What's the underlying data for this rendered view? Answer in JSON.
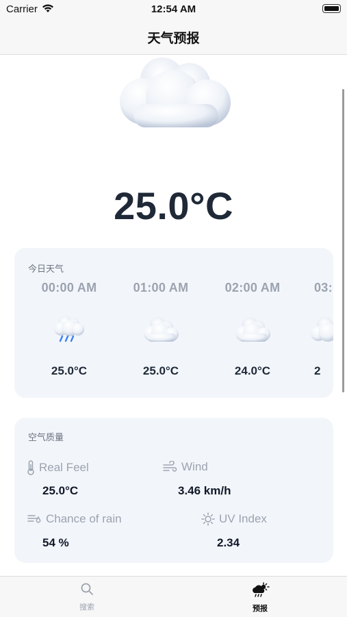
{
  "status_bar": {
    "carrier": "Carrier",
    "time": "12:54 AM"
  },
  "nav": {
    "title": "天气预报"
  },
  "current": {
    "temperature": "25.0°C",
    "icon": "cloud-icon"
  },
  "hourly": {
    "title": "今日天气",
    "items": [
      {
        "time": "00:00 AM",
        "icon": "rain-cloud-icon",
        "temp": "25.0°C"
      },
      {
        "time": "01:00 AM",
        "icon": "cloud-icon",
        "temp": "25.0°C"
      },
      {
        "time": "02:00 AM",
        "icon": "cloud-icon",
        "temp": "24.0°C"
      },
      {
        "time": "03:",
        "icon": "cloud-icon",
        "temp": "2"
      }
    ]
  },
  "air_quality": {
    "title": "空气质量",
    "real_feel": {
      "label": "Real Feel",
      "value": "25.0°C",
      "icon": "thermometer-icon"
    },
    "wind": {
      "label": "Wind",
      "value": "3.46 km/h",
      "icon": "wind-icon"
    },
    "rain": {
      "label": "Chance of rain",
      "value": "54 %",
      "icon": "rain-chance-icon"
    },
    "uv": {
      "label": "UV Index",
      "value": "2.34",
      "icon": "sun-icon"
    }
  },
  "tabs": [
    {
      "label": "搜索",
      "icon": "search-icon",
      "selected": false
    },
    {
      "label": "预报",
      "icon": "weather-icon",
      "selected": true
    }
  ],
  "colors": {
    "card_background": "#f2f6fb",
    "temperature_text": "#1f2937",
    "muted_text": "#9ca3af"
  }
}
